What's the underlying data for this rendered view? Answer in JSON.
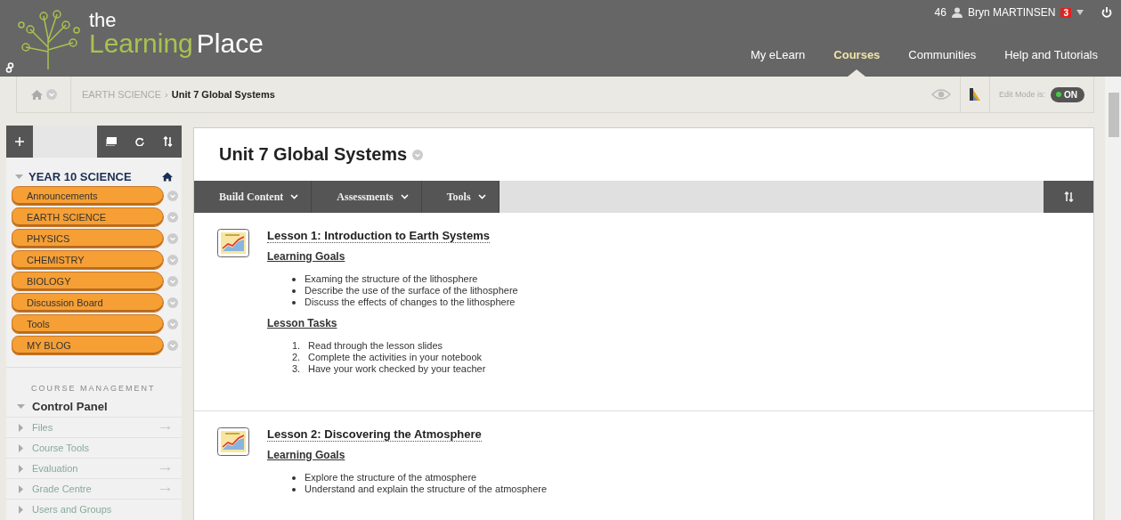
{
  "logo": {
    "line1": "the",
    "word1": "Learning",
    "word2": "Place"
  },
  "user_bar": {
    "count": "46",
    "user": "Bryn MARTINSEN",
    "badge": "3"
  },
  "nav_tabs": [
    {
      "label": "My eLearn",
      "selected": false
    },
    {
      "label": "Courses",
      "selected": true
    },
    {
      "label": "Communities",
      "selected": false
    },
    {
      "label": "Help and Tutorials",
      "selected": false
    }
  ],
  "breadcrumb": {
    "parent": "EARTH SCIENCE",
    "separator": "›",
    "current": "Unit 7 Global Systems"
  },
  "edit_mode": {
    "label": "Edit Mode is:",
    "value": "ON",
    "on": true
  },
  "sidebar": {
    "course": {
      "title": "YEAR 10 SCIENCE",
      "expanded": true
    },
    "menu_items": [
      {
        "label": "Announcements"
      },
      {
        "label": "EARTH SCIENCE"
      },
      {
        "label": "PHYSICS"
      },
      {
        "label": "CHEMISTRY"
      },
      {
        "label": "BIOLOGY"
      },
      {
        "label": "Discussion Board"
      },
      {
        "label": "Tools"
      },
      {
        "label": "MY BLOG"
      }
    ],
    "management_heading": "COURSE MANAGEMENT",
    "control_panel": {
      "title": "Control Panel",
      "expanded": true
    },
    "panel_items": [
      {
        "label": "Files",
        "expanded": false,
        "arrow": true
      },
      {
        "label": "Course Tools",
        "expanded": false,
        "arrow": false
      },
      {
        "label": "Evaluation",
        "expanded": false,
        "arrow": true
      },
      {
        "label": "Grade Centre",
        "expanded": false,
        "arrow": true
      },
      {
        "label": "Users and Groups",
        "expanded": false,
        "arrow": false
      }
    ]
  },
  "page_title": "Unit 7 Global Systems",
  "action_bar": [
    "Build Content",
    "Assessments",
    "Tools"
  ],
  "lessons": [
    {
      "title": "Lesson 1: Introduction to Earth Systems",
      "sections": [
        {
          "heading": "Learning Goals",
          "kind": "bullets",
          "items": [
            {
              "text": "Examing the structure of the lithosphere"
            },
            {
              "text": "Describe the use of the surface of the lithosphere"
            },
            {
              "text": "Discuss the effects of changes to the lithosphere"
            }
          ]
        },
        {
          "heading": "Lesson Tasks",
          "kind": "numbered",
          "items": [
            {
              "number": "1.",
              "text": "Read through the lesson slides"
            },
            {
              "number": "2.",
              "text": "Complete the activities in your notebook"
            },
            {
              "number": "3.",
              "text": "Have your work checked by your teacher"
            }
          ]
        }
      ]
    },
    {
      "title": "Lesson 2: Discovering the Atmosphere",
      "sections": [
        {
          "heading": "Learning Goals",
          "kind": "bullets",
          "items": [
            {
              "text": "Explore the structure of the atmosphere"
            },
            {
              "text": "Understand and explain the structure of the atmosphere"
            }
          ]
        }
      ]
    }
  ]
}
